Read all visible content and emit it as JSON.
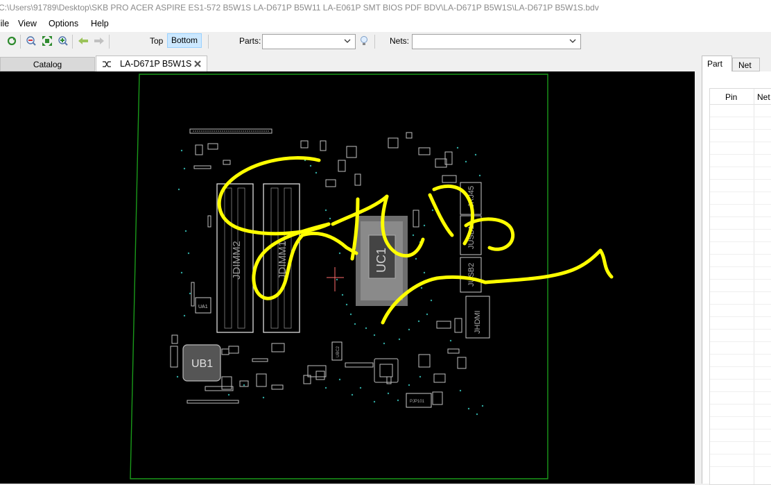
{
  "window": {
    "title": "C:\\Users\\91789\\Desktop\\SKB PRO ACER ASPIRE ES1-572 B5W1S LA-D671P B5W11 LA-E061P SMT BIOS PDF BDV\\LA-D671P B5W1S\\LA-D671P B5W1S.bdv"
  },
  "menu": {
    "file": "File",
    "view": "View",
    "options": "Options",
    "help": "Help"
  },
  "toolbar": {
    "top_label": "Top",
    "bottom_label": "Bottom",
    "parts_label": "Parts:",
    "parts_value": "",
    "nets_label": "Nets:",
    "nets_value": ""
  },
  "tabs": {
    "catalog": "Catalog",
    "board": "LA-D671P B5W1S"
  },
  "right_panel": {
    "tab_part": "Part",
    "tab_net": "Net",
    "col_pin": "Pin",
    "col_net": "Net"
  },
  "board": {
    "labels": {
      "jdimm2": "JDIMM2",
      "jdimm1": "JDIMM1",
      "uc1": "UC1",
      "ub1": "UB1",
      "ua1": "UA1",
      "jrj45": "JRJ45",
      "jusb1": "JUSB1",
      "jusb2": "JUSB2",
      "jhdmi": "JHDMI",
      "ubc2": "UBC2",
      "pjp101": "PJP101"
    },
    "colors": {
      "background": "#000000",
      "outline": "#1a9b1a",
      "silk": "#c8c8c8",
      "pads": "#2fa7a0",
      "annotation": "#ffff00",
      "cursor": "#ff6b6b"
    }
  }
}
